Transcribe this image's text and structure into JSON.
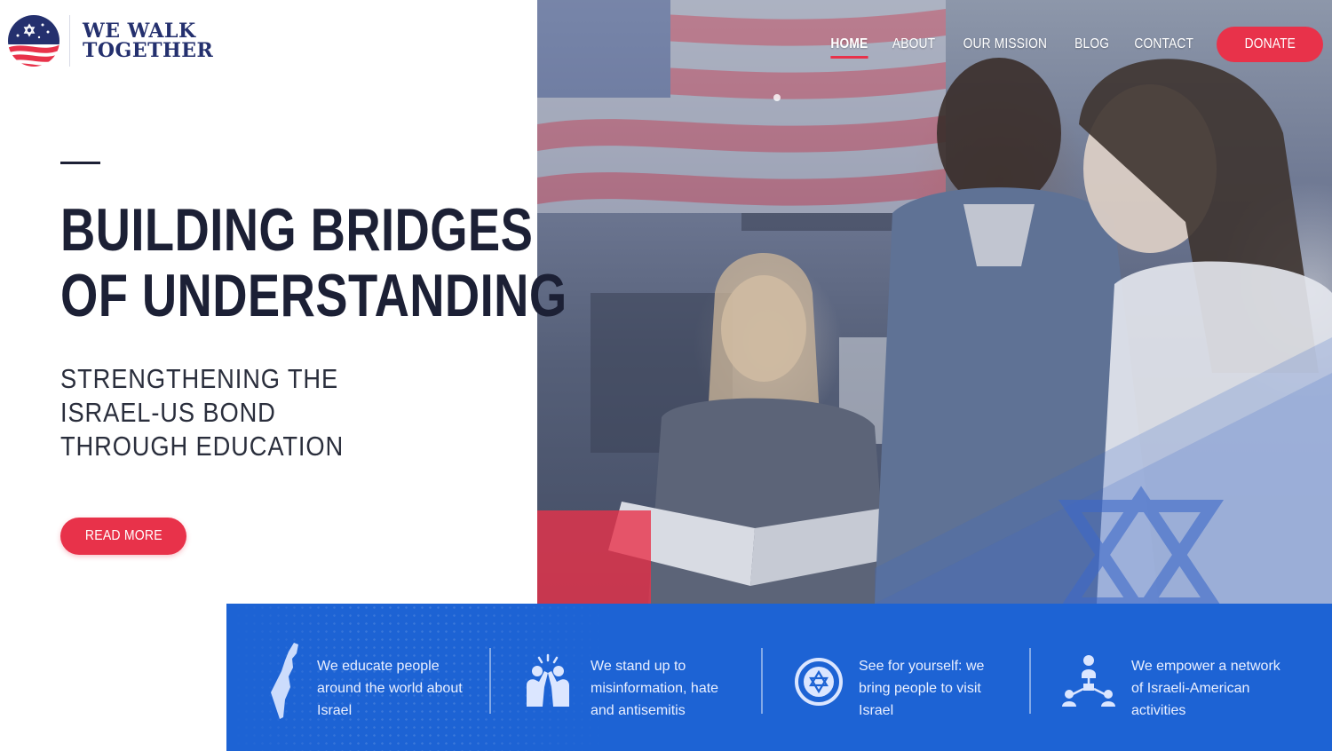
{
  "header": {
    "logo_line1": "WE WALK",
    "logo_line2": "TOGETHER",
    "nav": [
      {
        "label": "HOME",
        "active": true
      },
      {
        "label": "ABOUT"
      },
      {
        "label": "OUR MISSION"
      },
      {
        "label": "BLOG"
      },
      {
        "label": "CONTACT"
      }
    ],
    "donate_label": "DONATE"
  },
  "hero": {
    "title_line1": "BUILDING BRIDGES",
    "title_line2": "OF UNDERSTANDING",
    "subtitle_line1": "STRENGTHENING THE",
    "subtitle_line2": "ISRAEL-US BOND",
    "subtitle_line3": "THROUGH EDUCATION",
    "cta_label": "READ MORE"
  },
  "features": [
    {
      "icon": "israel-map-icon",
      "lines": [
        "We educate people",
        "around the world about",
        "Israel"
      ]
    },
    {
      "icon": "people-standing-icon",
      "lines": [
        "We stand up to",
        "misinformation, hate",
        "and antisemitis"
      ]
    },
    {
      "icon": "star-of-david-badge-icon",
      "lines": [
        "See for yourself: we",
        "bring people to visit",
        "Israel"
      ]
    },
    {
      "icon": "network-icon",
      "lines": [
        "We empower a network",
        "of Israeli-American",
        "activities"
      ]
    }
  ],
  "colors": {
    "accent_red": "#e8324a",
    "navy": "#24306e",
    "feature_blue": "#1d63d4",
    "heading_dark": "#1c2035"
  }
}
